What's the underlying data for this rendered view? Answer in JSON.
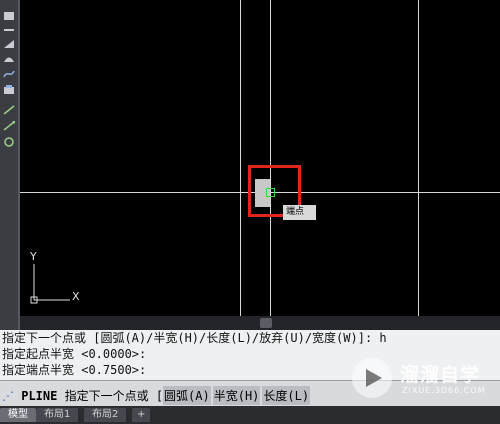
{
  "history": {
    "line1": "指定下一个点或 [圆弧(A)/半宽(H)/长度(L)/放弃(U)/宽度(W)]: h",
    "line2": "指定起点半宽 <0.0000>:",
    "line3": "指定端点半宽 <0.7500>:"
  },
  "command": {
    "prompt_icon": "⋰",
    "name": "PLINE",
    "text": "指定下一个点或 [",
    "options": [
      "圆弧(A)",
      "半宽(H)",
      "长度(L)"
    ]
  },
  "tabs": [
    "模型",
    "布局1",
    "布局2",
    "+"
  ],
  "canvas": {
    "ucs_y": "Y",
    "ucs_x": "X",
    "tooltip": "端点"
  },
  "watermark": {
    "title": "溜溜自学",
    "url": "ZIXUE.3D66.COM"
  },
  "colors": {
    "background": "#000000",
    "crosshair": "#d8d8d8",
    "highlight_box": "#e0251b",
    "snap_marker": "#3adb3a"
  }
}
